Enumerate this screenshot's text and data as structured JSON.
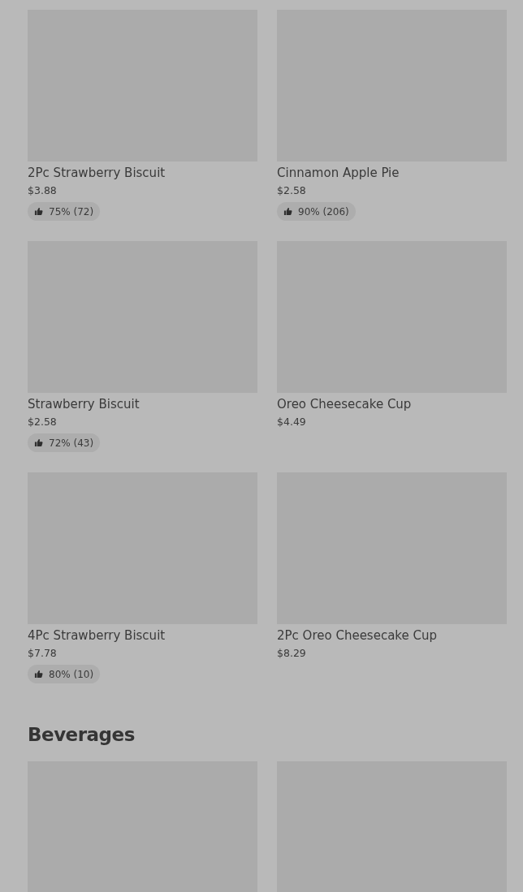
{
  "sections": [
    {
      "items": [
        {
          "kind": "product",
          "name": "2Pc Strawberry Biscuit",
          "price": "$3.88",
          "rating": "75% (72)"
        },
        {
          "kind": "product",
          "name": "Cinnamon Apple Pie",
          "price": "$2.58",
          "rating": "90% (206)"
        },
        {
          "kind": "product",
          "name": "Strawberry Biscuit",
          "price": "$2.58",
          "rating": "72% (43)"
        },
        {
          "kind": "product",
          "name": "Oreo Cheesecake Cup",
          "price": "$4.49"
        },
        {
          "kind": "product",
          "name": "4Pc Strawberry Biscuit",
          "price": "$7.78",
          "rating": "80% (10)"
        },
        {
          "kind": "product",
          "name": "2Pc Oreo Cheesecake Cup",
          "price": "$8.29"
        }
      ]
    },
    {
      "title": "Beverages",
      "items": [
        {
          "kind": "image-only"
        },
        {
          "kind": "image-only"
        }
      ]
    }
  ]
}
